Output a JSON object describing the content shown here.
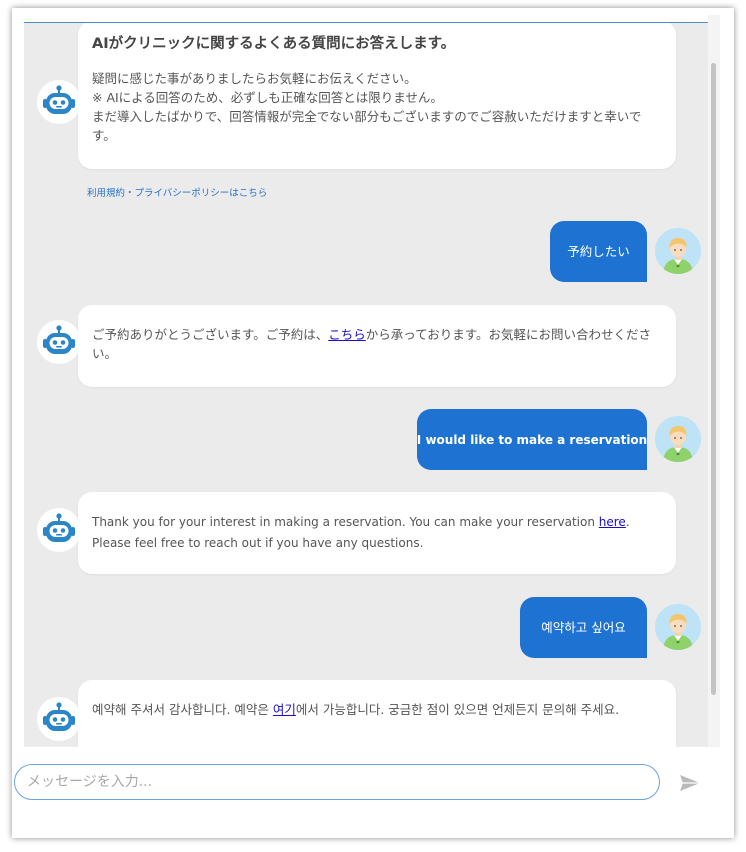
{
  "colors": {
    "accent": "#1e73d2",
    "chat_background": "#ebebeb",
    "link": "#1a0dcc"
  },
  "icons": {
    "bot_avatar": "robot-icon",
    "user_avatar": "person-icon",
    "send": "paper-plane-icon"
  },
  "welcome": {
    "title": "AIがクリニックに関するよくある質問にお答えします。",
    "line1": "疑問に感じた事がありましたらお気軽にお伝えください。",
    "line2": "※ AIによる回答のため、必ずしも正確な回答とは限りません。",
    "line3": "まだ導入したばかりで、回答情報が完全でない部分もございますのでご容赦いただけますと幸いです。",
    "policy_link": "利用規約・プライバシーポリシーはこちら"
  },
  "messages": [
    {
      "role": "user",
      "text": "予約したい"
    },
    {
      "role": "bot",
      "before": "ご予約ありがとうございます。ご予約は、",
      "link": "こちら",
      "after": "から承っております。お気軽にお問い合わせください。"
    },
    {
      "role": "user",
      "text": "I would like to make a reservation"
    },
    {
      "role": "bot",
      "before": "Thank you for your interest in making a reservation. You can make your reservation ",
      "link": "here",
      "after": ". Please feel free to reach out if you have any questions."
    },
    {
      "role": "user",
      "text": "예약하고 싶어요"
    },
    {
      "role": "bot",
      "before": "예약해 주셔서 감사합니다. 예약은 ",
      "link": "여기",
      "after": "에서 가능합니다. 궁금한 점이 있으면 언제든지 문의해 주세요."
    }
  ],
  "input": {
    "placeholder": "メッセージを入力..."
  }
}
